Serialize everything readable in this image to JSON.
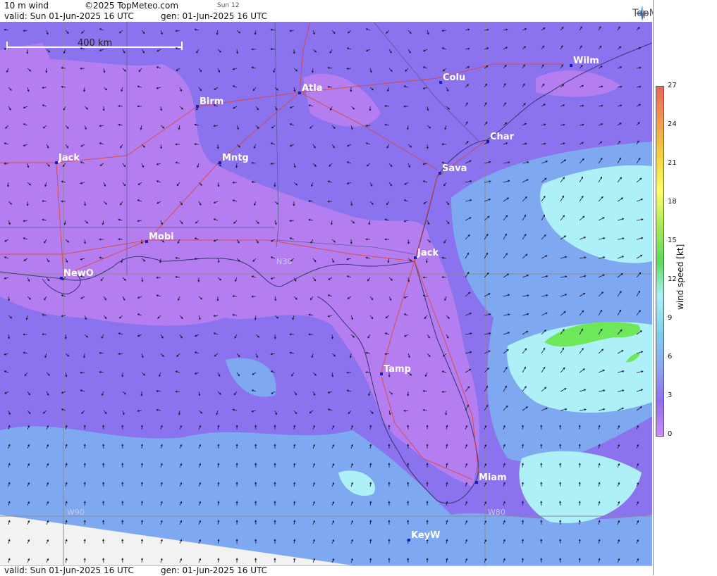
{
  "header": {
    "field": "10 m wind",
    "copyright": "©2025 TopMeteo.com",
    "panel": "Sun 12",
    "valid": "valid:  Sun  01-Jun-2025  16 UTC",
    "gen": "gen: 01-Jun-2025 16 UTC",
    "brand": "TopMeteo"
  },
  "footer": {
    "valid": "valid:  Sun  01-Jun-2025  16 UTC",
    "gen": "gen: 01-Jun-2025 16 UTC"
  },
  "scale_bar": "400 km",
  "gridlabels": {
    "lat": "N30",
    "lon1": "W90",
    "lon2": "W80"
  },
  "cities": [
    {
      "name": "Wilm"
    },
    {
      "name": "Colu"
    },
    {
      "name": "Atla"
    },
    {
      "name": "Birm"
    },
    {
      "name": "Char"
    },
    {
      "name": "Jack"
    },
    {
      "name": "Mntg"
    },
    {
      "name": "Sava"
    },
    {
      "name": "Mobi"
    },
    {
      "name": "Jack"
    },
    {
      "name": "NewO"
    },
    {
      "name": "Tamp"
    },
    {
      "name": "Miam"
    },
    {
      "name": "KeyW"
    }
  ],
  "legend": {
    "label": "wind speed  [kt]",
    "ticks": [
      "27",
      "24",
      "21",
      "18",
      "15",
      "12",
      "9",
      "6",
      "3",
      "0"
    ],
    "colors": [
      "#e8675a",
      "#f29a4f",
      "#f2d23c",
      "#ffff66",
      "#a8e85a",
      "#5ed95a",
      "#aef2f7",
      "#7ed0ec",
      "#8aa9f0",
      "#8f6ef0",
      "#c98cf5"
    ]
  }
}
